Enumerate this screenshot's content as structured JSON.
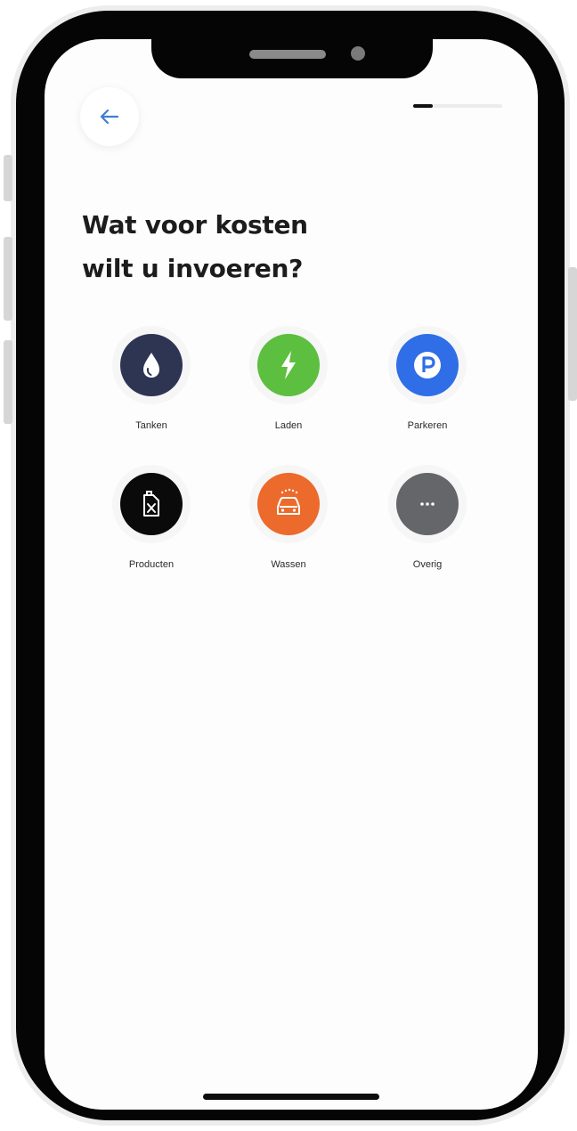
{
  "title_lines": [
    "Wat voor kosten",
    "wilt u invoeren?"
  ],
  "progress": 0.22,
  "categories": [
    {
      "label": "Tanken",
      "icon": "fuel-drop-icon",
      "color": "#2e3553"
    },
    {
      "label": "Laden",
      "icon": "lightning-icon",
      "color": "#5cbf3f"
    },
    {
      "label": "Parkeren",
      "icon": "parking-icon",
      "color": "#2f6ee6"
    },
    {
      "label": "Producten",
      "icon": "jerrycan-icon",
      "color": "#0a0a0a"
    },
    {
      "label": "Wassen",
      "icon": "car-wash-icon",
      "color": "#ec6a2c"
    },
    {
      "label": "Overig",
      "icon": "more-icon",
      "color": "#646669"
    }
  ],
  "colors": {
    "accent_back": "#3f7fd0",
    "text": "#1c1c1c"
  }
}
